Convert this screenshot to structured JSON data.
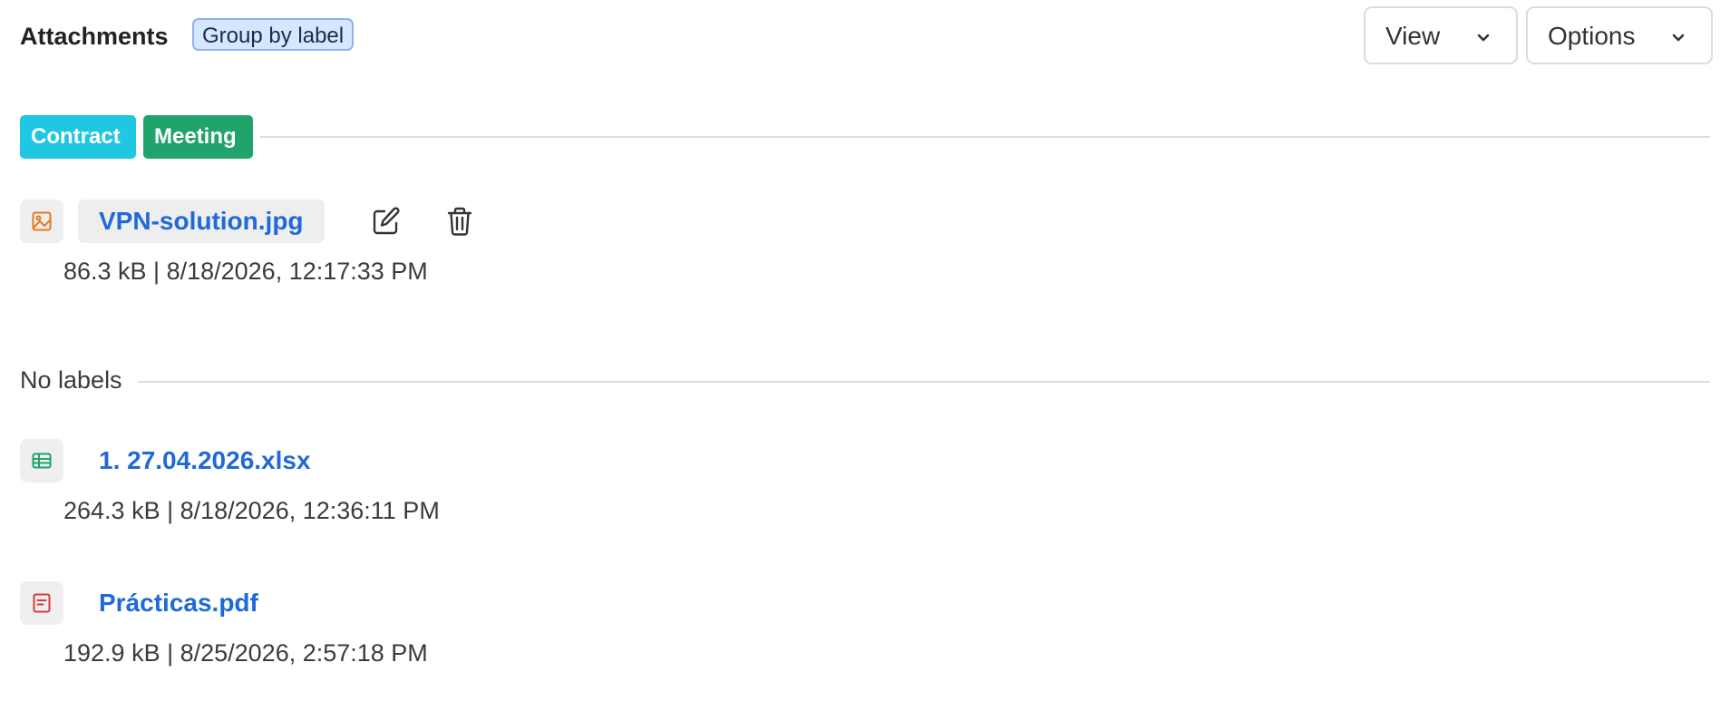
{
  "header": {
    "title": "Attachments",
    "group_chip": "Group by label",
    "view_label": "View",
    "options_label": "Options"
  },
  "labels_group": {
    "tags": [
      {
        "label": "Contract",
        "color": "#1fc7e3"
      },
      {
        "label": "Meeting",
        "color": "#20a46b"
      }
    ],
    "items": [
      {
        "name": "VPN-solution.jpg",
        "meta": "86.3 kB | 8/18/2026, 12:17:33 PM",
        "icon": "image-file-icon",
        "icon_color": "#e8771e"
      }
    ]
  },
  "no_labels_group": {
    "title": "No labels",
    "items": [
      {
        "name": "1. 27.04.2026.xlsx",
        "meta": "264.3 kB | 8/18/2026, 12:36:11 PM",
        "icon": "spreadsheet-file-icon",
        "icon_color": "#20a46b"
      },
      {
        "name": "Prácticas.pdf",
        "meta": "192.9 kB | 8/25/2026, 2:57:18 PM",
        "icon": "document-file-icon",
        "icon_color": "#d63b3b"
      }
    ]
  },
  "colors": {
    "link": "#1f6ad6",
    "chip_bg": "#d7e6ff",
    "chip_border": "#8fb3ea"
  }
}
